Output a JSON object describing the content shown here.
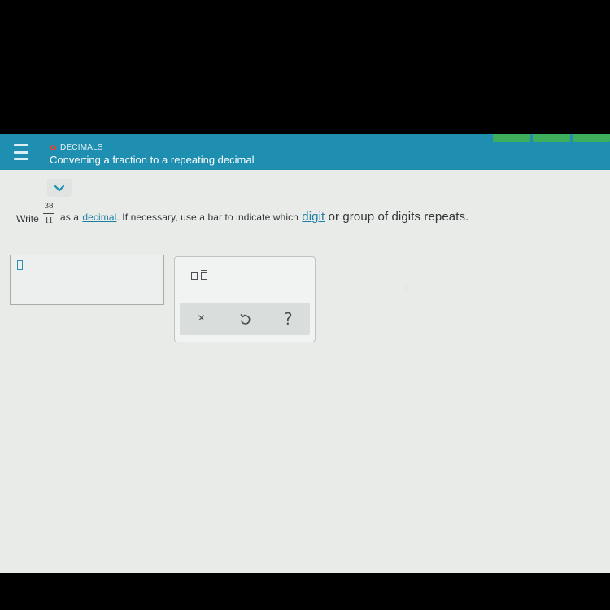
{
  "header": {
    "topic": "DECIMALS",
    "title": "Converting a fraction to a repeating decimal"
  },
  "question": {
    "write": "Write",
    "numerator": "38",
    "denominator": "11",
    "as_a": "as a",
    "decimal_link": "decimal",
    "middle": ". If necessary, use a bar to indicate which",
    "digit_link": "digit",
    "end": "or group of digits repeats."
  },
  "toolbar": {
    "clear_label": "×",
    "help_label": "?"
  },
  "icons": {
    "menu": "menu-icon",
    "chevron": "chevron-down-icon",
    "repeat_bar": "repeating-bar-icon",
    "undo": "undo-icon"
  },
  "colors": {
    "header": "#1e8fb0",
    "topic_dot": "#e2443a",
    "link": "#1e7fa6",
    "top_tab": "#3fae5c"
  }
}
